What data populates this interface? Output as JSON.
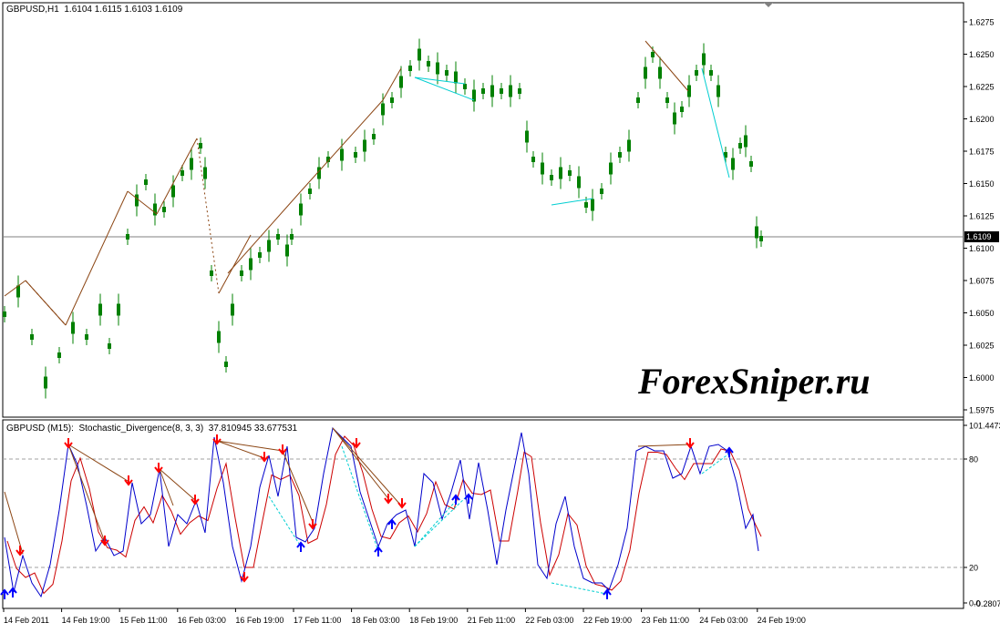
{
  "main": {
    "header": {
      "symbol": "GBPUSD,H1",
      "ohlc": "1.6104 1.6115 1.6103 1.6109"
    },
    "price_ticks": [
      "1.6275",
      "1.6250",
      "1.6225",
      "1.6200",
      "1.6175",
      "1.6150",
      "1.6125",
      "1.6100",
      "1.6075",
      "1.6050",
      "1.6025",
      "1.6000",
      "1.5975"
    ],
    "current_price": "1.6109",
    "watermark": "ForexSniper.ru",
    "colors": {
      "up": "#008000",
      "down": "#008000",
      "trend_brown": "#8B4513",
      "trend_cyan": "#00CED1",
      "grid": "#808080"
    }
  },
  "indicator": {
    "header": {
      "symbol": "GBPUSD (M15):",
      "name": "Stochastic_Divergence(8, 3, 3)",
      "values": "37.810945 33.677531"
    },
    "ticks": [
      "101.4473",
      "80",
      "20",
      "0.0"
    ],
    "bottom_tick": "-0.2807",
    "colors": {
      "main_line": "#0000CC",
      "signal_line": "#CC0000",
      "arrow_down": "#FF0000",
      "arrow_up": "#0000FF"
    }
  },
  "time_axis": [
    "14 Feb 2011",
    "14 Feb 19:00",
    "15 Feb 11:00",
    "16 Feb 03:00",
    "16 Feb 19:00",
    "17 Feb 11:00",
    "18 Feb 03:00",
    "18 Feb 19:00",
    "21 Feb 11:00",
    "22 Feb 03:00",
    "22 Feb 19:00",
    "23 Feb 11:00",
    "24 Feb 03:00",
    "24 Feb 19:00"
  ]
}
